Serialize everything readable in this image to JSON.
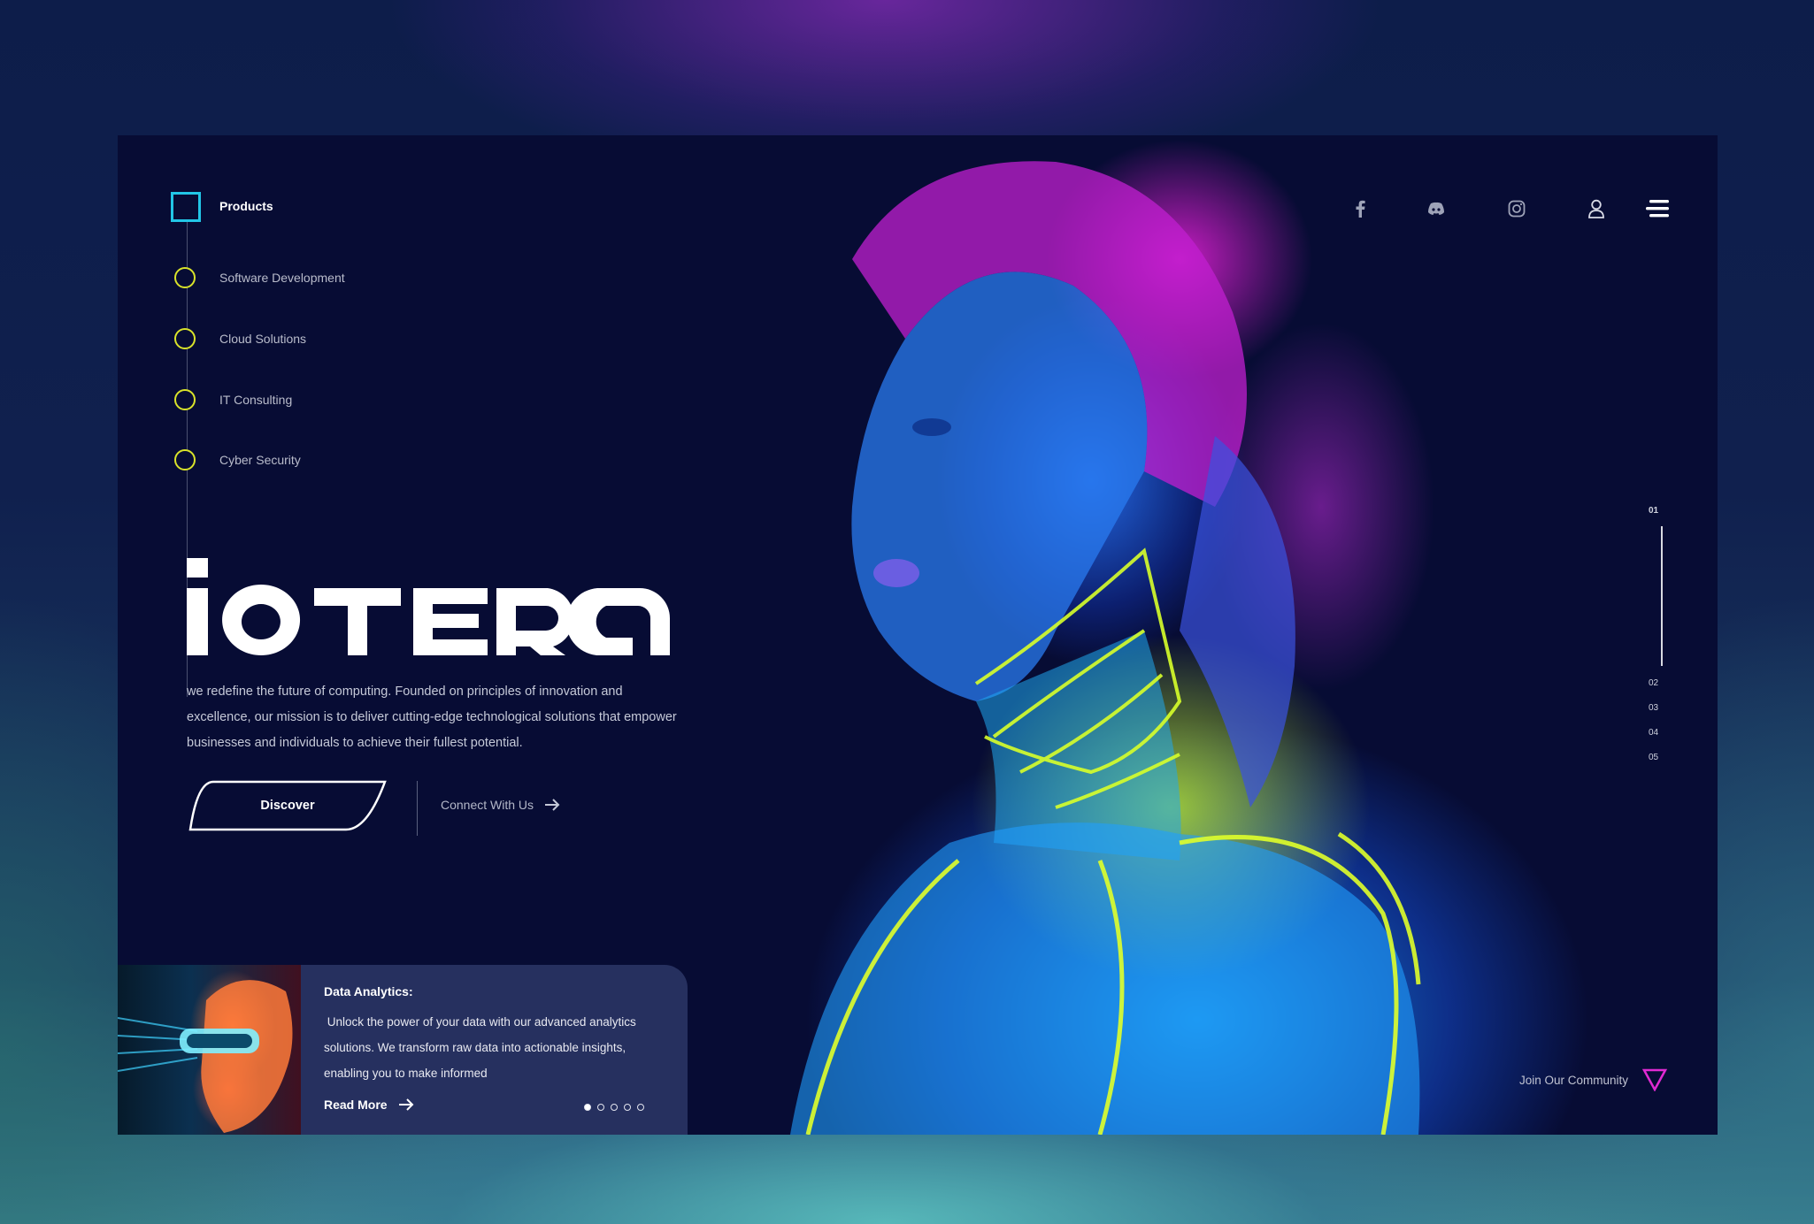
{
  "nav": {
    "header": "Products",
    "items": [
      {
        "label": "Software Development"
      },
      {
        "label": "Cloud Solutions"
      },
      {
        "label": "IT Consulting"
      },
      {
        "label": "Cyber Security"
      }
    ]
  },
  "hero": {
    "brand": "iOTERA",
    "description": "we redefine the future of computing. Founded on principles of innovation and excellence, our mission is to deliver cutting-edge technological solutions that empower businesses and individuals to achieve their fullest potential.",
    "primary_button": "Discover",
    "secondary_link": "Connect With Us"
  },
  "header_icons": [
    "facebook-icon",
    "discord-icon",
    "instagram-icon",
    "user-icon",
    "menu-icon"
  ],
  "pager": {
    "items": [
      "01",
      "02",
      "03",
      "04",
      "05"
    ],
    "active_index": 0
  },
  "info_card": {
    "title": "Data Analytics:",
    "body": " Unlock the power of your data with our advanced analytics solutions. We transform raw data into actionable insights, enabling you to make informed",
    "link": "Read More",
    "dots_total": 5,
    "dots_active": 0
  },
  "community": {
    "label": "Join Our Community"
  },
  "colors": {
    "background": "#070c34",
    "accent_cyan": "#22c6e6",
    "accent_yellow": "#d9e32a",
    "accent_magenta": "#e02ad2",
    "card": "#26305f"
  }
}
